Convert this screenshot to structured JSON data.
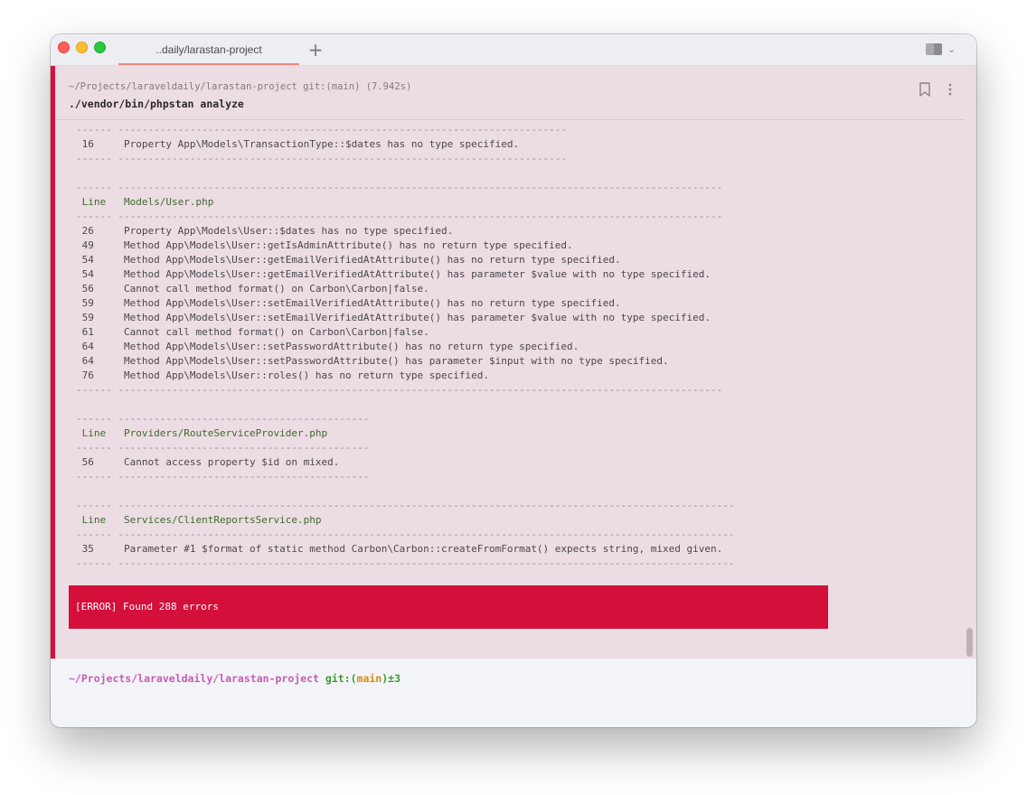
{
  "window": {
    "tab_title": "..daily/larastan-project",
    "new_tab_label": "+"
  },
  "command": {
    "meta": "~/Projects/laraveldaily/larastan-project git:(main) (7.942s)",
    "text": "./vendor/bin/phpstan analyze"
  },
  "icons": {
    "bookmark": "bookmark-icon",
    "more": "more-vertical-icon",
    "split": "split-pane-icon",
    "chevron": "chevron-down-icon"
  },
  "output_lines": [
    {
      "kind": "dash",
      "text": "------ ---------------------------------------------------------------------------"
    },
    {
      "kind": "row",
      "text": " 16     Property App\\Models\\TransactionType::$dates has no type specified."
    },
    {
      "kind": "dash",
      "text": "------ ---------------------------------------------------------------------------"
    },
    {
      "kind": "blank",
      "text": ""
    },
    {
      "kind": "dash",
      "text": "------ -----------------------------------------------------------------------------------------------------"
    },
    {
      "kind": "header",
      "text": " Line   Models/User.php"
    },
    {
      "kind": "dash",
      "text": "------ -----------------------------------------------------------------------------------------------------"
    },
    {
      "kind": "row",
      "text": " 26     Property App\\Models\\User::$dates has no type specified."
    },
    {
      "kind": "row",
      "text": " 49     Method App\\Models\\User::getIsAdminAttribute() has no return type specified."
    },
    {
      "kind": "row",
      "text": " 54     Method App\\Models\\User::getEmailVerifiedAtAttribute() has no return type specified."
    },
    {
      "kind": "row",
      "text": " 54     Method App\\Models\\User::getEmailVerifiedAtAttribute() has parameter $value with no type specified."
    },
    {
      "kind": "row",
      "text": " 56     Cannot call method format() on Carbon\\Carbon|false."
    },
    {
      "kind": "row",
      "text": " 59     Method App\\Models\\User::setEmailVerifiedAtAttribute() has no return type specified."
    },
    {
      "kind": "row",
      "text": " 59     Method App\\Models\\User::setEmailVerifiedAtAttribute() has parameter $value with no type specified."
    },
    {
      "kind": "row",
      "text": " 61     Cannot call method format() on Carbon\\Carbon|false."
    },
    {
      "kind": "row",
      "text": " 64     Method App\\Models\\User::setPasswordAttribute() has no return type specified."
    },
    {
      "kind": "row",
      "text": " 64     Method App\\Models\\User::setPasswordAttribute() has parameter $input with no type specified."
    },
    {
      "kind": "row",
      "text": " 76     Method App\\Models\\User::roles() has no return type specified."
    },
    {
      "kind": "dash",
      "text": "------ -----------------------------------------------------------------------------------------------------"
    },
    {
      "kind": "blank",
      "text": ""
    },
    {
      "kind": "dash",
      "text": "------ ------------------------------------------"
    },
    {
      "kind": "header",
      "text": " Line   Providers/RouteServiceProvider.php"
    },
    {
      "kind": "dash",
      "text": "------ ------------------------------------------"
    },
    {
      "kind": "row",
      "text": " 56     Cannot access property $id on mixed."
    },
    {
      "kind": "dash",
      "text": "------ ------------------------------------------"
    },
    {
      "kind": "blank",
      "text": ""
    },
    {
      "kind": "dash",
      "text": "------ -------------------------------------------------------------------------------------------------------"
    },
    {
      "kind": "header",
      "text": " Line   Services/ClientReportsService.php"
    },
    {
      "kind": "dash",
      "text": "------ -------------------------------------------------------------------------------------------------------"
    },
    {
      "kind": "row",
      "text": " 35     Parameter #1 $format of static method Carbon\\Carbon::createFromFormat() expects string, mixed given."
    },
    {
      "kind": "dash",
      "text": "------ -------------------------------------------------------------------------------------------------------"
    }
  ],
  "error_banner": "[ERROR] Found 288 errors",
  "prompt": {
    "path": "~/Projects/laraveldaily/larastan-project",
    "git_prefix": "git:(",
    "branch": "main",
    "git_suffix": ")",
    "dirty": "±3"
  },
  "colors": {
    "block_background": "#ecdce3",
    "error_accent": "#d30f3a",
    "header_green": "#3e6b2c"
  }
}
